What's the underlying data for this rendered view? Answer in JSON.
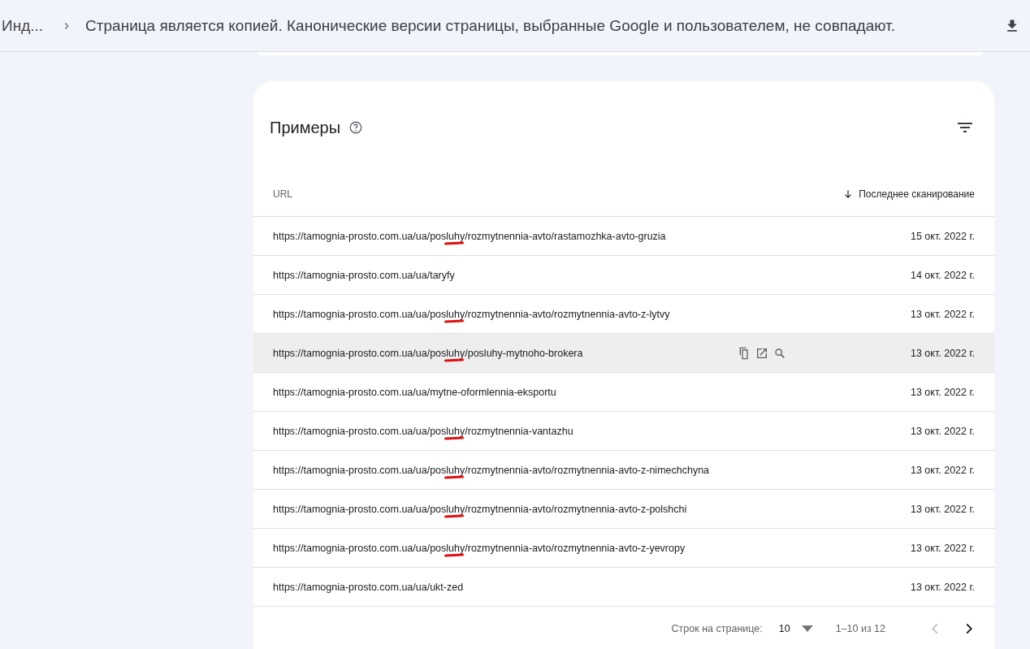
{
  "breadcrumb": {
    "parent": "Инд...",
    "title": "Страница является копией. Канонические версии страницы, выбранные Google и пользователем, не совпадают."
  },
  "examples": {
    "title": "Примеры",
    "columns": [
      {
        "label": "URL",
        "sorted": false
      },
      {
        "label": "Последнее сканирование",
        "sorted": true
      }
    ],
    "rows": [
      {
        "url": "https://tamognia-prosto.com.ua/ua/posluhy/rozmytnennia-avto/rastamozhka-avto-gruzia",
        "date": "15 окт. 2022 г.",
        "hovered": false,
        "marked": true
      },
      {
        "url": "https://tamognia-prosto.com.ua/ua/taryfy",
        "date": "14 окт. 2022 г.",
        "hovered": false,
        "marked": false
      },
      {
        "url": "https://tamognia-prosto.com.ua/ua/posluhy/rozmytnennia-avto/rozmytnennia-avto-z-lytvy",
        "date": "13 окт. 2022 г.",
        "hovered": false,
        "marked": true
      },
      {
        "url": "https://tamognia-prosto.com.ua/ua/posluhy/posluhy-mytnoho-brokera",
        "date": "13 окт. 2022 г.",
        "hovered": true,
        "marked": true
      },
      {
        "url": "https://tamognia-prosto.com.ua/ua/mytne-oformlennia-eksportu",
        "date": "13 окт. 2022 г.",
        "hovered": false,
        "marked": false
      },
      {
        "url": "https://tamognia-prosto.com.ua/ua/posluhy/rozmytnennia-vantazhu",
        "date": "13 окт. 2022 г.",
        "hovered": false,
        "marked": true
      },
      {
        "url": "https://tamognia-prosto.com.ua/ua/posluhy/rozmytnennia-avto/rozmytnennia-avto-z-nimechchyna",
        "date": "13 окт. 2022 г.",
        "hovered": false,
        "marked": true
      },
      {
        "url": "https://tamognia-prosto.com.ua/ua/posluhy/rozmytnennia-avto/rozmytnennia-avto-z-polshchi",
        "date": "13 окт. 2022 г.",
        "hovered": false,
        "marked": true
      },
      {
        "url": "https://tamognia-prosto.com.ua/ua/posluhy/rozmytnennia-avto/rozmytnennia-avto-z-yevropy",
        "date": "13 окт. 2022 г.",
        "hovered": false,
        "marked": true
      },
      {
        "url": "https://tamognia-prosto.com.ua/ua/ukt-zed",
        "date": "13 окт. 2022 г.",
        "hovered": false,
        "marked": false
      }
    ],
    "pagination": {
      "rows_label": "Строк на странице:",
      "rows_value": "10",
      "range": "1–10 из 12",
      "prev_disabled": true,
      "next_disabled": false
    }
  }
}
